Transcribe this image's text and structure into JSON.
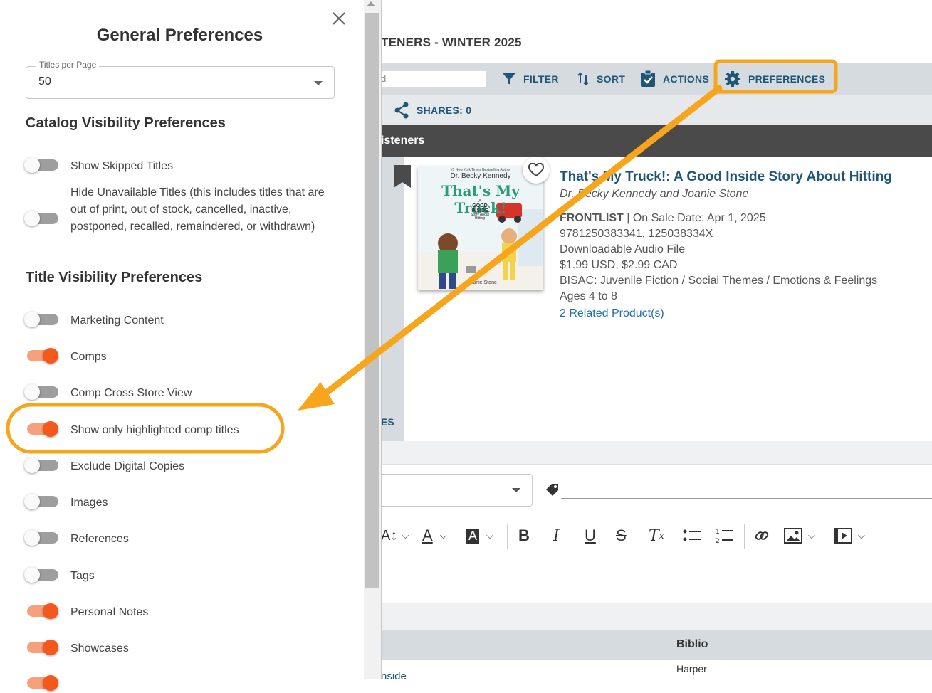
{
  "panel": {
    "title": "General Preferences",
    "titles_per_page": {
      "label": "Titles per Page",
      "value": "50"
    },
    "catalog_section": "Catalog Visibility Preferences",
    "catalog_prefs": [
      {
        "label": "Show Skipped Titles",
        "on": false
      },
      {
        "label": "Hide Unavailable Titles (this includes titles that are out of print, out of stock, cancelled, inactive, postponed, recalled, remaindered, or withdrawn)",
        "on": false
      }
    ],
    "title_section": "Title Visibility Preferences",
    "title_prefs": [
      {
        "label": "Marketing Content",
        "on": false
      },
      {
        "label": "Comps",
        "on": true
      },
      {
        "label": "Comp Cross Store View",
        "on": false
      },
      {
        "label": "Show only highlighted comp titles",
        "on": true
      },
      {
        "label": "Exclude Digital Copies",
        "on": false
      },
      {
        "label": "Images",
        "on": false
      },
      {
        "label": "References",
        "on": false
      },
      {
        "label": "Tags",
        "on": false
      },
      {
        "label": "Personal Notes",
        "on": true
      },
      {
        "label": "Showcases",
        "on": true
      }
    ]
  },
  "catalog": {
    "title": "TENERS - WINTER 2025",
    "search_partial": "d",
    "toolbar": {
      "filter": "FILTER",
      "sort": "SORT",
      "actions": "ACTIONS",
      "preferences": "PREFERENCES"
    },
    "shares": "SHARES: 0",
    "section_bar": "isteners",
    "side_text": "ES"
  },
  "book": {
    "cover": {
      "top_line": "#1 New York Times Bestselling Author",
      "author": "Dr. Becky Kennedy",
      "title": "That's My Truck!",
      "series_a": "A",
      "series_b": "GOOD",
      "series_c": "INSIDE",
      "series_d": "Story About",
      "series_e": "Hitting",
      "illustrator": "Joanie Stone"
    },
    "title": "That's My Truck!: A Good Inside Story About Hitting",
    "authors": "Dr. Becky Kennedy and Joanie Stone",
    "status": "FRONTLIST",
    "on_sale": "| On Sale Date: Apr 1, 2025",
    "isbn": "9781250383341, 125038334X",
    "format": "Downloadable Audio File",
    "price": "$1.99 USD, $2.99 CAD",
    "bisac": "BISAC: Juvenile Fiction / Social Themes / Emotions & Feelings",
    "ages": "Ages 4 to 8",
    "related": "2 Related Product(s)"
  },
  "table": {
    "col_biblio": "Biblio",
    "cell_harper": "Harper",
    "cell_link": "nside"
  },
  "colors": {
    "accent": "#f5581c",
    "annotation": "#f6a51c",
    "brand": "#1f5678"
  },
  "icons": [
    "close-icon",
    "dropdown-arrow-icon",
    "filter-icon",
    "sort-icon",
    "actions-icon",
    "gear-icon",
    "share-icon",
    "bookmark-icon",
    "heart-icon",
    "tag-icon",
    "bold-icon",
    "italic-icon",
    "underline-icon",
    "strikethrough-icon",
    "clear-format-icon",
    "bullet-list-icon",
    "numbered-list-icon",
    "link-icon",
    "image-icon",
    "video-icon"
  ]
}
